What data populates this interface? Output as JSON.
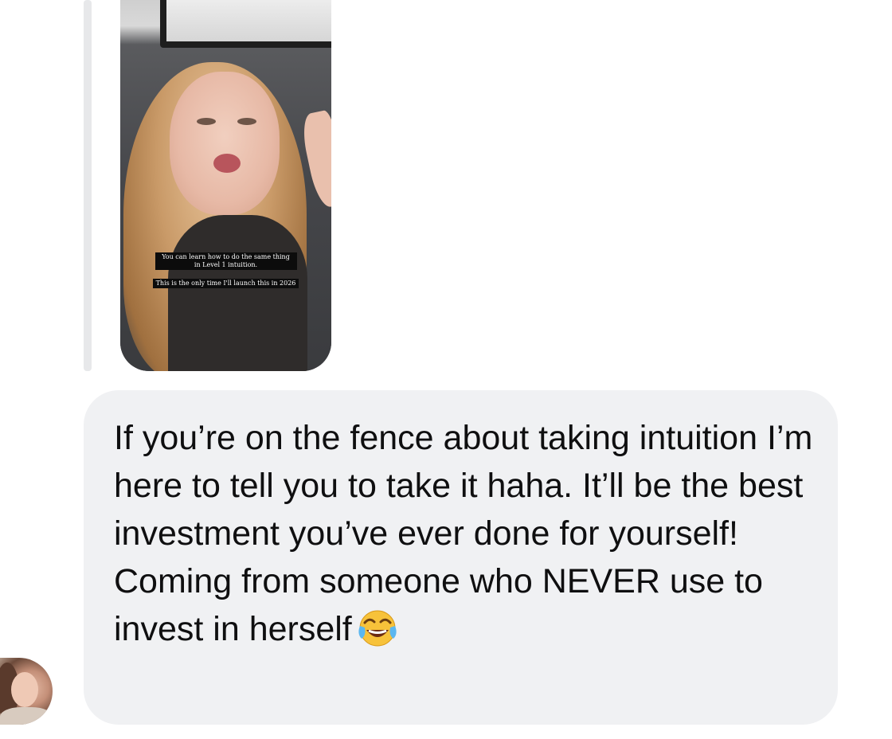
{
  "story": {
    "caption_line1": "You can learn how to do the same thing in Level 1 intuition.",
    "caption_line2": "This is the only time I'll launch this in 2026"
  },
  "message": {
    "text": "If you’re on the fence about taking intuition I’m here to tell you to take it haha. It’ll be the best investment you’ve ever done for yourself! Coming from someone who NEVER use to invest in herself",
    "emoji": "face-with-tears-of-joy-icon"
  },
  "colors": {
    "bubble_background": "#f0f1f3",
    "quote_bar": "#e7e8ea",
    "text": "#0f0f10"
  }
}
